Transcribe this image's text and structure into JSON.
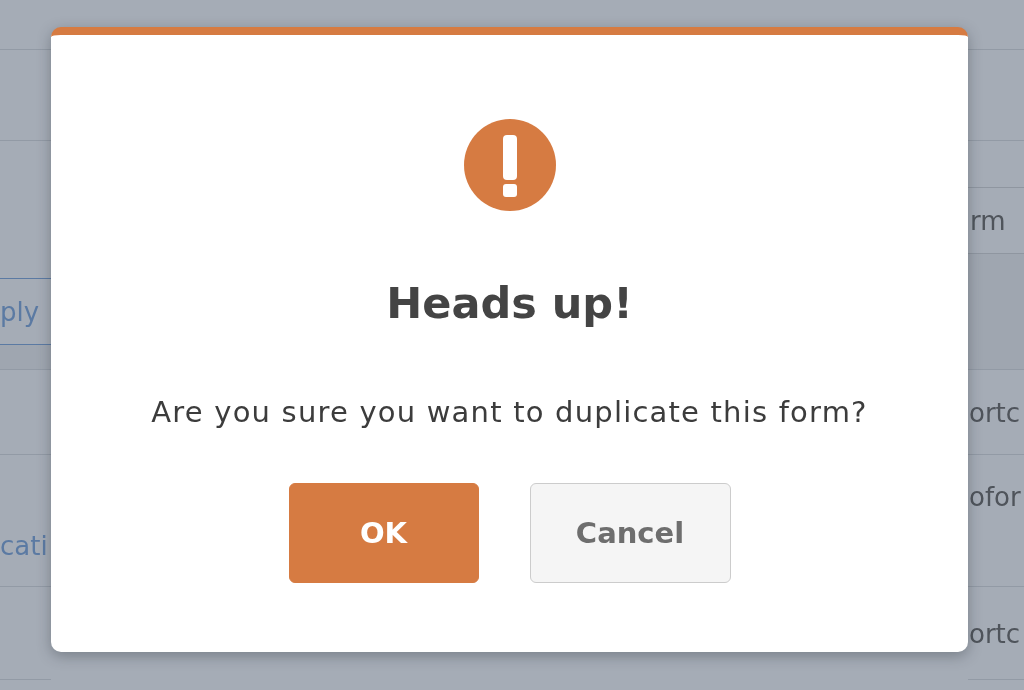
{
  "background": {
    "left_button": "ply",
    "right_button": "rm",
    "rows": [
      {
        "right_cell": "ortc"
      },
      {
        "left_cell": "cati",
        "right_cell": "ofor"
      },
      {
        "right_cell": "ortc"
      }
    ]
  },
  "dialog": {
    "title": "Heads up!",
    "message": "Are you sure you want to duplicate this form?",
    "buttons": [
      {
        "label": "OK",
        "kind": "primary"
      },
      {
        "label": "Cancel",
        "kind": "secondary"
      }
    ]
  }
}
